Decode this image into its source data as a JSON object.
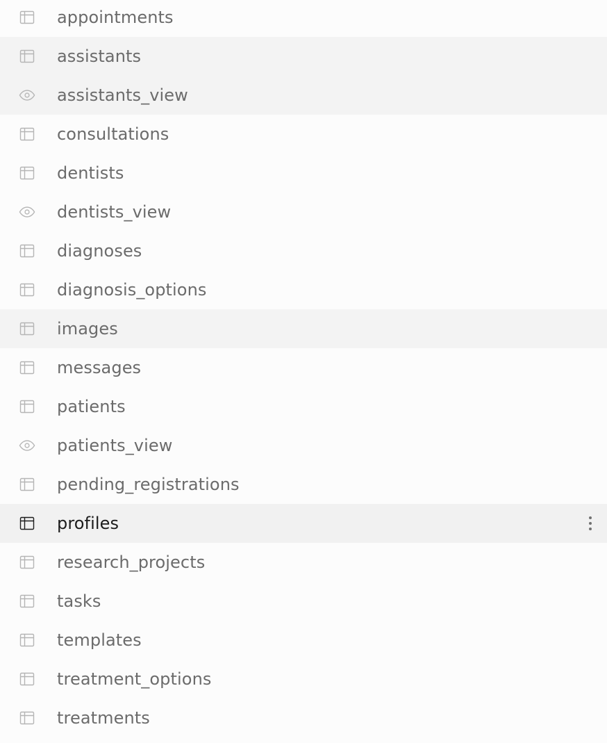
{
  "tables": [
    {
      "name": "appointments",
      "icon": "table-icon",
      "state": "normal"
    },
    {
      "name": "assistants",
      "icon": "table-icon",
      "state": "highlight"
    },
    {
      "name": "assistants_view",
      "icon": "eye-icon",
      "state": "highlight"
    },
    {
      "name": "consultations",
      "icon": "table-icon",
      "state": "normal"
    },
    {
      "name": "dentists",
      "icon": "table-icon",
      "state": "normal"
    },
    {
      "name": "dentists_view",
      "icon": "eye-icon",
      "state": "normal"
    },
    {
      "name": "diagnoses",
      "icon": "table-icon",
      "state": "normal"
    },
    {
      "name": "diagnosis_options",
      "icon": "table-icon",
      "state": "normal"
    },
    {
      "name": "images",
      "icon": "table-icon",
      "state": "highlight"
    },
    {
      "name": "messages",
      "icon": "table-icon",
      "state": "normal"
    },
    {
      "name": "patients",
      "icon": "table-icon",
      "state": "normal"
    },
    {
      "name": "patients_view",
      "icon": "eye-icon",
      "state": "normal"
    },
    {
      "name": "pending_registrations",
      "icon": "table-icon",
      "state": "normal"
    },
    {
      "name": "profiles",
      "icon": "table-icon",
      "state": "selected"
    },
    {
      "name": "research_projects",
      "icon": "table-icon",
      "state": "normal"
    },
    {
      "name": "tasks",
      "icon": "table-icon",
      "state": "normal"
    },
    {
      "name": "templates",
      "icon": "table-icon",
      "state": "normal"
    },
    {
      "name": "treatment_options",
      "icon": "table-icon",
      "state": "normal"
    },
    {
      "name": "treatments",
      "icon": "table-icon",
      "state": "normal"
    }
  ],
  "colors": {
    "icon_muted": "#b5b5b5",
    "icon_active": "#1c1c1c",
    "text_muted": "#6b6b6b",
    "text_active": "#1c1c1c"
  }
}
